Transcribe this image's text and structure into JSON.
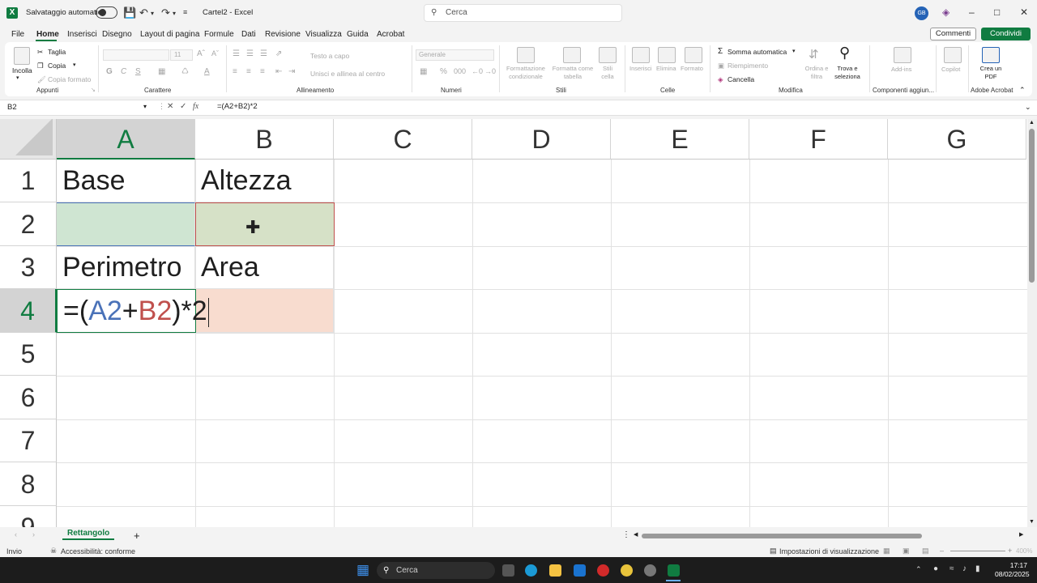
{
  "titlebar": {
    "autosave_label": "Salvataggio automatico",
    "doc_title": "Cartel2 - Excel",
    "search_placeholder": "Cerca",
    "avatar_initials": "GB"
  },
  "menu": {
    "items": [
      "File",
      "Home",
      "Inserisci",
      "Disegno",
      "Layout di pagina",
      "Formule",
      "Dati",
      "Revisione",
      "Visualizza",
      "Guida",
      "Acrobat"
    ],
    "active": "Home",
    "comments_label": "Commenti",
    "share_label": "Condividi"
  },
  "ribbon": {
    "incolla": "Incolla",
    "taglia": "Taglia",
    "copia": "Copia",
    "copia_formato": "Copia formato",
    "font_size": "11",
    "bold": "G",
    "italic": "C",
    "underline": "S",
    "testo_a_capo": "Testo a capo",
    "unisci": "Unisci e allinea al centro",
    "number_format": "Generale",
    "formattazione_condizionale": "Formattazione condizionale",
    "formatta_come_tabella": "Formatta come tabella",
    "stili_cella": "Stili cella",
    "inserisci": "Inserisci",
    "elimina": "Elimina",
    "formato": "Formato",
    "somma_automatica": "Somma automatica",
    "riempimento": "Riempimento",
    "cancella": "Cancella",
    "ordina_filtra": "Ordina e filtra",
    "trova_seleziona": "Trova e seleziona",
    "add_ins": "Add-ins",
    "copilot": "Copilot",
    "crea_pdf": "Crea un PDF",
    "groups": {
      "appunti": "Appunti",
      "carattere": "Carattere",
      "allineamento": "Allineamento",
      "numeri": "Numeri",
      "stili": "Stili",
      "celle": "Celle",
      "modifica": "Modifica",
      "componenti": "Componenti aggiun...",
      "adobe": "Adobe Acrobat"
    }
  },
  "formula_bar": {
    "name_box": "B2",
    "content": "=(A2+B2)*2"
  },
  "grid": {
    "columns": [
      "A",
      "B",
      "C",
      "D",
      "E",
      "F",
      "G"
    ],
    "rows": [
      "1",
      "2",
      "3",
      "4",
      "5",
      "6",
      "7",
      "8",
      "9"
    ],
    "selected_column": "A",
    "selected_row": "4",
    "cells": {
      "A1": "Base",
      "B1": "Altezza",
      "A3": "Perimetro",
      "B3": "Area",
      "A4_prefix": "=(",
      "A4_ref1": "A2",
      "A4_plus": "+",
      "A4_ref2": "B2",
      "A4_suffix": ")*2"
    },
    "ref_colors": {
      "A2": "#4a72b8",
      "B2": "#c0504d"
    }
  },
  "sheets": {
    "tabs": [
      "Rettangolo"
    ],
    "active": "Rettangolo"
  },
  "status": {
    "mode": "Invio",
    "accessibility": "Accessibilità: conforme",
    "display_settings": "Impostazioni di visualizzazione",
    "zoom": "400%"
  },
  "taskbar": {
    "search_placeholder": "Cerca",
    "time": "17:17",
    "date": "08/02/2025"
  },
  "colors": {
    "excel_green": "#107c41",
    "selection_fill": "#cfe5d2",
    "ref_b2_fill": "#d6e1c7",
    "b4_fill": "#f8dccf"
  }
}
